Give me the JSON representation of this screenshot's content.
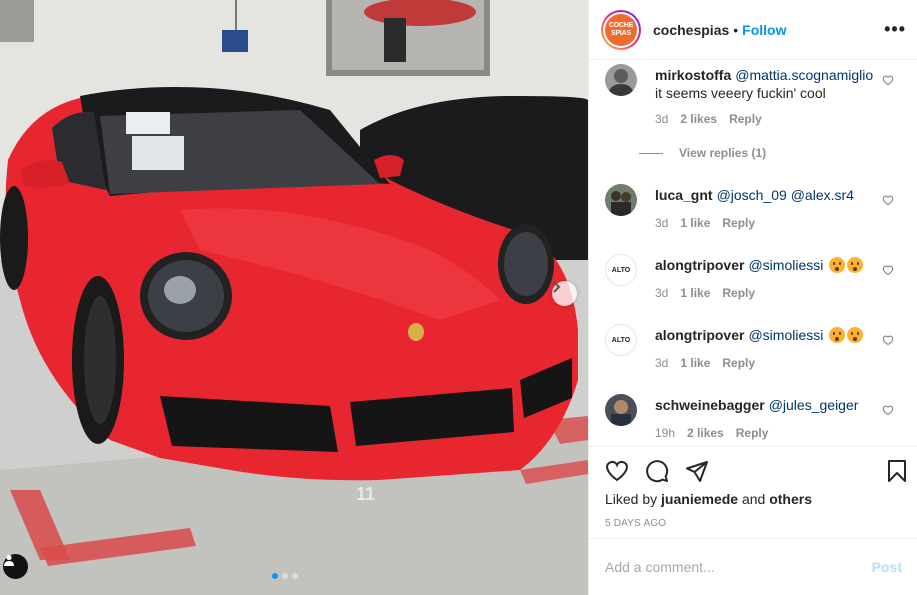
{
  "header": {
    "logo_text_line1": "COCHE",
    "logo_text_line2": "SPIAS",
    "username": "cochespias",
    "separator": "•",
    "follow_label": "Follow",
    "more_icon": "more-horizontal-icon",
    "more_label": "•••"
  },
  "photo": {
    "floor_mark": "11",
    "dots_total": 3,
    "dots_active": 0
  },
  "comments": [
    {
      "user": "mirkostoffa",
      "mention": "@mattia.scognamiglio",
      "text": "it seems veeery fuckin' cool",
      "time": "3d",
      "likes": "2 likes",
      "reply": "Reply",
      "view_replies": "View replies (1)"
    },
    {
      "user": "luca_gnt",
      "mention": "@josch_09 @alex.sr4",
      "text": "",
      "time": "3d",
      "likes": "1 like",
      "reply": "Reply"
    },
    {
      "user": "alongtripover",
      "avatar_text": "ALTO",
      "mention": "@simoliessi",
      "text": "",
      "time": "3d",
      "likes": "1 like",
      "reply": "Reply"
    },
    {
      "user": "alongtripover",
      "avatar_text": "ALTO",
      "mention": "@simoliessi",
      "text": "",
      "time": "3d",
      "likes": "1 like",
      "reply": "Reply"
    },
    {
      "user": "schweinebagger",
      "mention": "@jules_geiger",
      "text": "",
      "time": "19h",
      "likes": "2 likes",
      "reply": "Reply"
    }
  ],
  "actions": {
    "liked_by_prefix": "Liked by",
    "liked_by_user": "juaniemede",
    "liked_by_and": "and",
    "liked_by_others": "others",
    "time_ago": "5 DAYS AGO"
  },
  "add_comment": {
    "placeholder": "Add a comment...",
    "post_label": "Post"
  },
  "colors": {
    "accent": "#0095f6",
    "car_red": "#e8262f",
    "logo_orange": "#f26a2e"
  }
}
